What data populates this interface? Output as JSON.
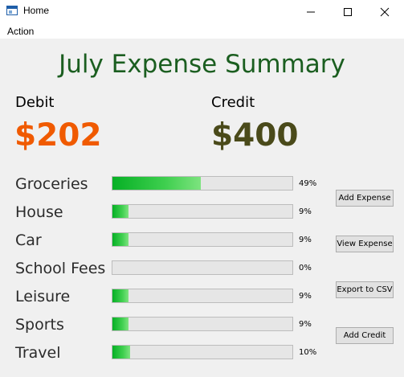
{
  "window": {
    "title": "Home",
    "controls": [
      "minimize-icon",
      "maximize-icon",
      "close-icon"
    ]
  },
  "menu": {
    "items": [
      {
        "label": "Action"
      }
    ]
  },
  "summary": {
    "title": "July Expense Summary",
    "debit_label": "Debit",
    "debit_amount": "$202",
    "credit_label": "Credit",
    "credit_amount": "$400",
    "colors": {
      "title": "#1b5e20",
      "debit": "#f05a00",
      "credit": "#4a4a1a"
    }
  },
  "categories": [
    {
      "label": "Groceries",
      "percent_text": "49%",
      "fraction": 0.49
    },
    {
      "label": "House",
      "percent_text": "9%",
      "fraction": 0.09
    },
    {
      "label": "Car",
      "percent_text": "9%",
      "fraction": 0.09
    },
    {
      "label": "School Fees",
      "percent_text": "0%",
      "fraction": 0.0
    },
    {
      "label": "Leisure",
      "percent_text": "9%",
      "fraction": 0.09
    },
    {
      "label": "Sports",
      "percent_text": "9%",
      "fraction": 0.09
    },
    {
      "label": "Travel",
      "percent_text": "10%",
      "fraction": 0.1
    }
  ],
  "actions": {
    "add_expense": "Add Expense",
    "view_expense": "View Expense",
    "export_csv": "Export to CSV",
    "add_credit": "Add Credit"
  }
}
